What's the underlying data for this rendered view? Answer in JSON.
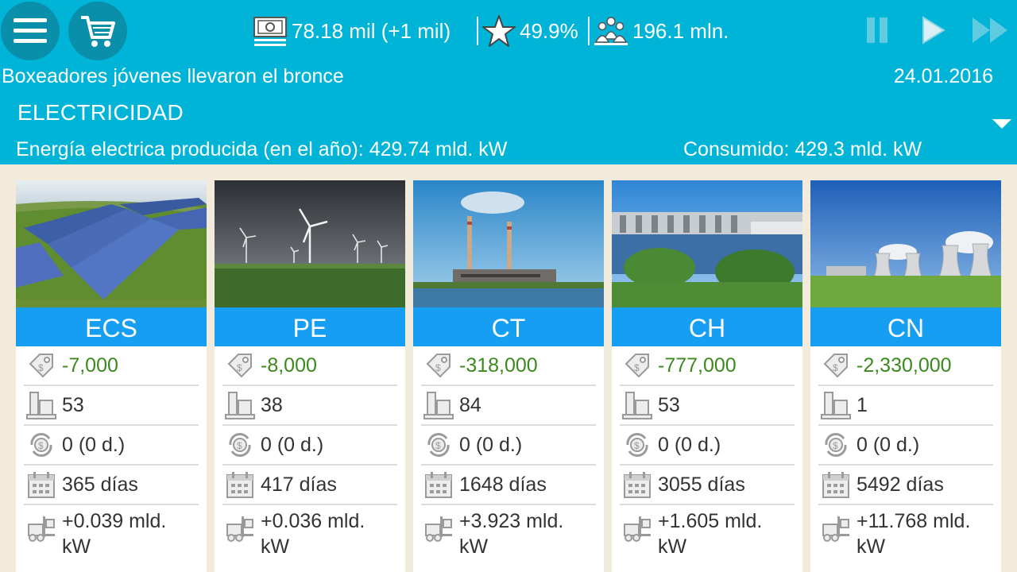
{
  "header": {
    "money": "78.18 mil (+1 mil)",
    "rating": "49.9%",
    "population": "196.1 mln.",
    "news": "Boxeadores jóvenes llevaron el bronce",
    "date": "24.01.2016",
    "section_title": "ELECTRICIDAD",
    "produced": "Energía electrica producida (en el año): 429.74 mld. kW",
    "consumed": "Consumido: 429.3 mld. kW"
  },
  "icons": {
    "menu": "menu-icon",
    "cart": "cart-icon",
    "money": "money-icon",
    "rating": "star-icon",
    "population": "people-icon",
    "pause": "pause-icon",
    "play": "play-icon",
    "fast_forward": "fast-forward-icon",
    "price": "price-tag-icon",
    "count": "buildings-icon",
    "income": "money-cycle-icon",
    "days": "calendar-icon",
    "output": "forklift-icon"
  },
  "colors": {
    "header_bg": "#00b4d8",
    "card_title_bg": "#169ef2",
    "positive_value": "#3a8a1c",
    "page_bg": "#f2ebdc"
  },
  "cards": [
    {
      "title": "ECS",
      "image": "solar panels field",
      "price": "-7,000",
      "count": "53",
      "income": "0 (0 d.)",
      "days": "365 días",
      "output": "+0.039 mld. kW"
    },
    {
      "title": "PE",
      "image": "wind turbines under storm clouds",
      "price": "-8,000",
      "count": "38",
      "income": "0 (0 d.)",
      "days": "417 días",
      "output": "+0.036 mld. kW"
    },
    {
      "title": "CT",
      "image": "thermal power plant with chimneys",
      "price": "-318,000",
      "count": "84",
      "income": "0 (0 d.)",
      "days": "1648 días",
      "output": "+3.923 mld. kW"
    },
    {
      "title": "CH",
      "image": "hydroelectric dam",
      "price": "-777,000",
      "count": "53",
      "income": "0 (0 d.)",
      "days": "3055 días",
      "output": "+1.605 mld. kW"
    },
    {
      "title": "CN",
      "image": "nuclear plant cooling towers",
      "price": "-2,330,000",
      "count": "1",
      "income": "0 (0 d.)",
      "days": "5492 días",
      "output": "+11.768 mld. kW"
    }
  ]
}
